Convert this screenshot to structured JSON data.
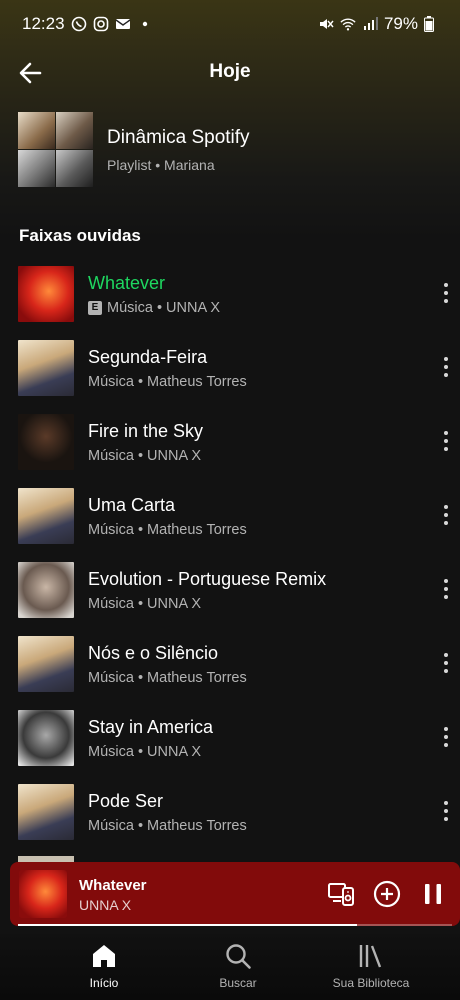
{
  "status_bar": {
    "time": "12:23",
    "battery": "79%"
  },
  "header": {
    "title": "Hoje"
  },
  "context": {
    "title": "Dinâmica Spotify",
    "subtitle": "Playlist • Mariana"
  },
  "section_title": "Faixas ouvidas",
  "tracks": [
    {
      "title": "Whatever",
      "subtitle": "Música • UNNA X",
      "explicit": "E",
      "active": true
    },
    {
      "title": "Segunda-Feira",
      "subtitle": "Música • Matheus Torres"
    },
    {
      "title": "Fire in the Sky",
      "subtitle": "Música • UNNA X"
    },
    {
      "title": "Uma Carta",
      "subtitle": "Música • Matheus Torres"
    },
    {
      "title": "Evolution - Portuguese Remix",
      "subtitle": "Música • UNNA X"
    },
    {
      "title": "Nós e o Silêncio",
      "subtitle": "Música • Matheus Torres"
    },
    {
      "title": "Stay in America",
      "subtitle": "Música • UNNA X"
    },
    {
      "title": "Pode Ser",
      "subtitle": "Música • Matheus Torres"
    }
  ],
  "mini_player": {
    "title": "Whatever",
    "artist": "UNNA X",
    "progress": 0.78
  },
  "bottom_nav": [
    {
      "label": "Início",
      "icon": "home-icon",
      "active": true
    },
    {
      "label": "Buscar",
      "icon": "search-icon"
    },
    {
      "label": "Sua Biblioteca",
      "icon": "library-icon"
    }
  ],
  "colors": {
    "accent": "#1ed760",
    "mini_player_bg": "#820b0b",
    "background": "#121212"
  }
}
